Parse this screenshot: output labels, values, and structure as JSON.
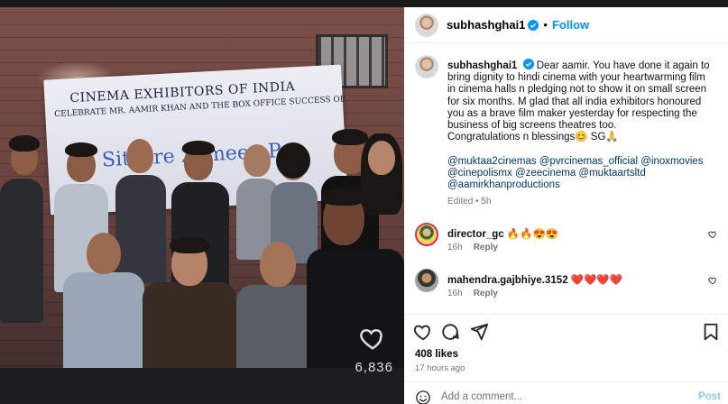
{
  "post": {
    "username": "subhashghai1",
    "follow_label": "Follow",
    "separator": "•",
    "caption": {
      "username": "subhashghai1",
      "body": "Dear aamir. You have done it again to bring dignity to hindi cinema with your heartwarming film in cinema halls n pledging not to show it on small screen for six months. M glad that all india exhibitors honoured you as a brave film maker yesterday for respecting the business of big screens theatres too.",
      "closing": "Congratulations n blessings😊 SG🙏",
      "tags": "@muktaa2cinemas @pvrcinemas_official @inoxmovies @cinepolismx @zeecinema @muktaartsltd @aamirkhanproductions",
      "edited": "Edited • 5h"
    },
    "comments": [
      {
        "username": "director_gc",
        "text": "🔥🔥😍😍",
        "time": "16h",
        "reply": "Reply"
      },
      {
        "username": "mahendra.gajbhiye.3152",
        "text": "❤️❤️❤️❤️",
        "time": "16h",
        "reply": "Reply"
      }
    ],
    "likes": "408 likes",
    "time_ago": "17 hours ago",
    "add_comment_placeholder": "Add a comment...",
    "post_label": "Post"
  },
  "media": {
    "banner_line1": "CINEMA EXHIBITORS OF INDIA",
    "banner_line2": "CELEBRATE MR. AAMIR KHAN AND THE BOX OFFICE SUCCESS OF",
    "banner_line3": "Sitaare Zameen Par",
    "view_count": "6,836"
  },
  "colors": {
    "accent": "#0095f6",
    "tag": "#00376b",
    "muted": "#737373",
    "post_disabled": "#8ec9f9"
  },
  "icons": [
    "verified-badge-icon",
    "heart-icon",
    "comment-icon",
    "share-icon",
    "bookmark-icon",
    "emoji-icon",
    "more-icon"
  ]
}
